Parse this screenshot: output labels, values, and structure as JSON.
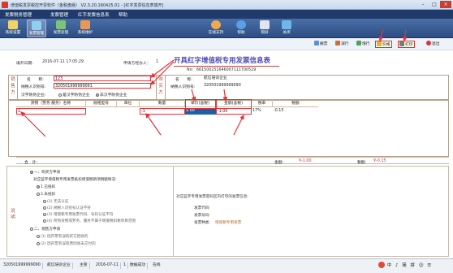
{
  "window": {
    "title": "增值税发票税控开票软件（金税盘版） V2.3.20.160425.01 - [红字发票信息表填开]"
  },
  "menu": [
    "发票税务管理",
    "发票管理",
    "红字发票信息表",
    "帮助"
  ],
  "toolbar": {
    "left": [
      "系统设置",
      "发票管理",
      "发票处理",
      "系统维护"
    ],
    "right": [
      "在线支持",
      "帮助",
      "锁屏",
      "关闭"
    ]
  },
  "actions": [
    "撤票",
    "减行",
    "增行",
    "价格",
    "打印",
    "退出"
  ],
  "header": {
    "title": "开具红字增值税专用发票信息表",
    "fill_date_label": "填开日期:",
    "fill_date": "2016-07-11 17:05:29",
    "applicant_label": "申请方经办人：",
    "applicant": "1",
    "no_label": "No:",
    "no": "661500251646007111700529"
  },
  "seller": {
    "side_label": "销售方",
    "name_label": "名　　称:",
    "name": "123",
    "tax_id_label": "纳税人识别号:",
    "tax_id": "320501999999091",
    "merge_label": "汉字防伪企业:",
    "opt_yes": "是汉字防伪企业",
    "opt_no": "非汉字防伪企业"
  },
  "buyer": {
    "side_label": "购买方",
    "name_label": "名　　称:",
    "name": "航信培训企业",
    "tax_id_label": "纳税人识别号:",
    "tax_id": "320501999999090"
  },
  "goods": {
    "headers": [
      "货物（劳务 服务）名称",
      "规格型号",
      "单位",
      "数量",
      "单价(含税)",
      "金额(含税)",
      "税率",
      "税额"
    ],
    "row": {
      "name": "1",
      "spec": "",
      "unit": "",
      "qty": "-1",
      "price": "1.00",
      "amount": "-1.00",
      "rate": "17%",
      "tax": "-0.15"
    }
  },
  "totals": {
    "label": "合　计:",
    "amount_label": "金额:",
    "amount": "¥-1.00",
    "tax_label": "税额:",
    "tax": "¥-0.15"
  },
  "notes": {
    "side_label": "说明",
    "left": [
      "一、购买方申请",
      "对应蓝字增值税专用发票抵扣增值税销项税额情况:",
      "1.已抵扣",
      "2.未抵扣",
      "(1) 无法认证",
      "(2) 纳税人识别号认证不符",
      "(3) 增值税专用发票代码、号码认证不符",
      "(4) 所购货物或劳务、服务不属于增值税扣税项目范围",
      "二、销售方申请",
      "(1) 因开票有误购买方拒收的",
      "(2) 因开票有误等原因尚未交付的"
    ],
    "right": {
      "heading": "对应蓝字专用发票密码区内打印的发票信息:",
      "code_label": "发票代码:",
      "number_label": "发票号码:",
      "type_label": "发票种类:",
      "type_value": "增值税专用发票"
    }
  },
  "status": [
    "320501999999090",
    "航信培训企业",
    "主管",
    "2016-07-11",
    "1",
    "数据成功",
    "在线"
  ],
  "tray": [
    "中",
    "♪",
    "简",
    "拼",
    "☺",
    "☰"
  ]
}
